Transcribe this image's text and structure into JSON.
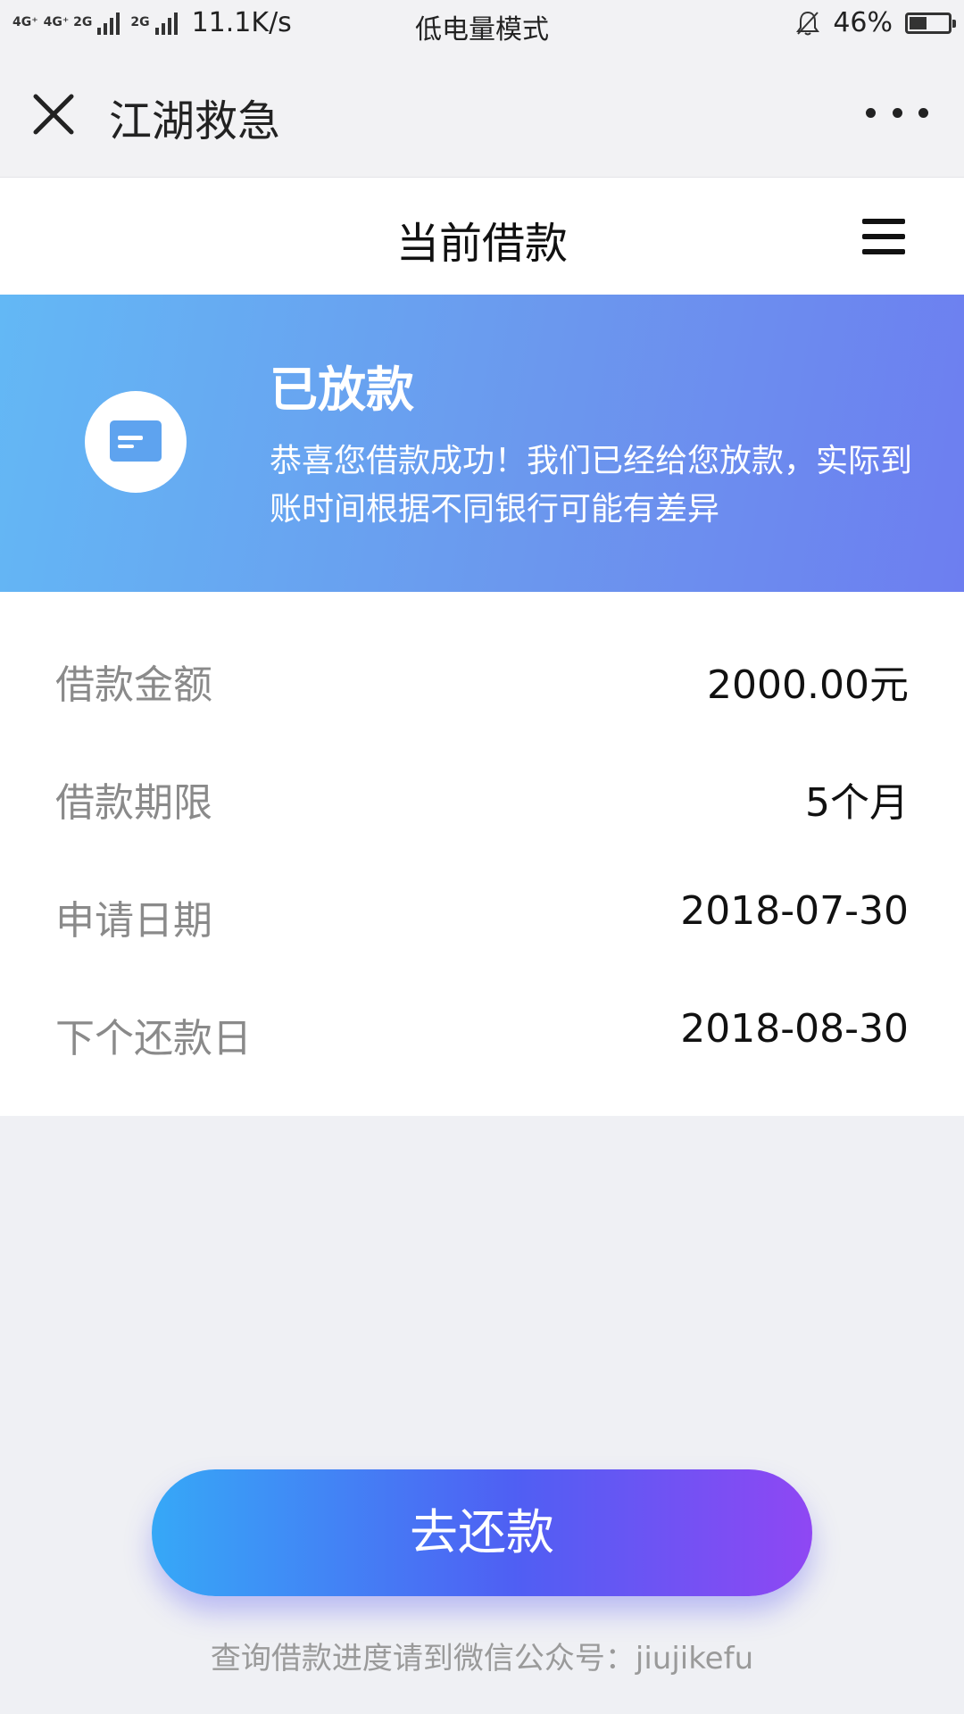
{
  "status_bar": {
    "network_1": "4G⁺",
    "network_2": "4G⁺ 2G",
    "network_3": "2G",
    "speed": "11.1K/s",
    "mode": "低电量模式",
    "battery_percent": "46%",
    "battery_level": 0.46
  },
  "nav": {
    "title": "江湖救急",
    "close_icon": "close-icon",
    "more_icon": "more-icon"
  },
  "page": {
    "title": "当前借款",
    "menu_icon": "menu-icon"
  },
  "banner": {
    "icon": "card-icon",
    "status_title": "已放款",
    "message": "恭喜您借款成功！我们已经给您放款，实际到账时间根据不同银行可能有差异",
    "colors": {
      "start": "#63b8f5",
      "end": "#6d7ef0"
    }
  },
  "details": [
    {
      "label": "借款金额",
      "value": "2000.00元"
    },
    {
      "label": "借款期限",
      "value": "5个月"
    },
    {
      "label": "申请日期",
      "value": "2018-07-30"
    },
    {
      "label": "下个还款日",
      "value": "2018-08-30"
    }
  ],
  "actions": {
    "repay_label": "去还款"
  },
  "footer": {
    "note": "查询借款进度请到微信公众号：jiujikefu"
  }
}
